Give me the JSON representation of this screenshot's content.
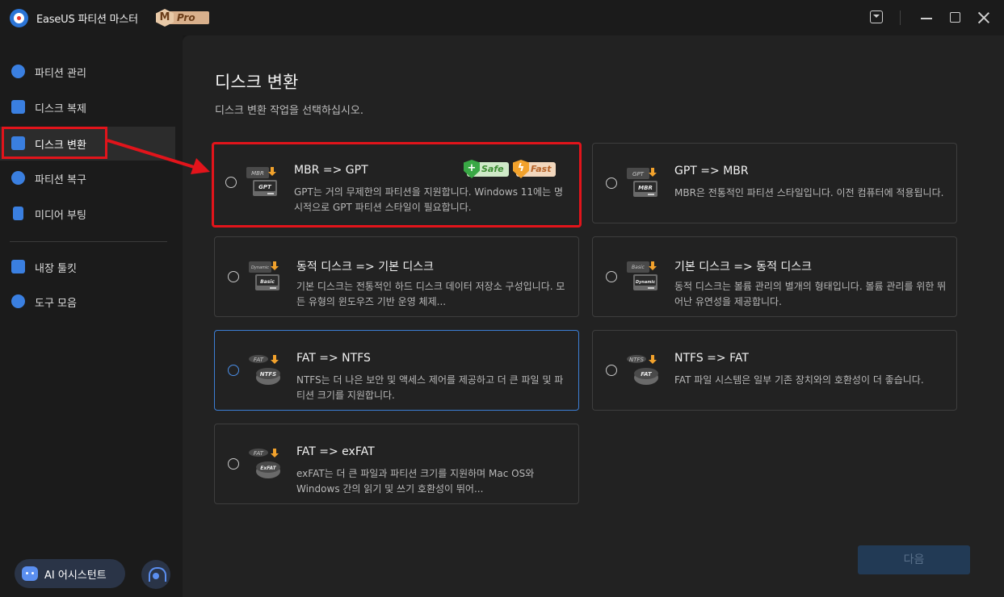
{
  "app": {
    "title": "EaseUS 파티션 마스터",
    "badge_letter": "M",
    "badge_text": "Pro"
  },
  "sidebar": {
    "items": [
      {
        "label": "파티션 관리",
        "icon": "partition-pie-icon"
      },
      {
        "label": "디스크 복제",
        "icon": "disk-clone-icon"
      },
      {
        "label": "디스크 변환",
        "icon": "disk-convert-icon",
        "active": true
      },
      {
        "label": "파티션 복구",
        "icon": "partition-recovery-icon"
      },
      {
        "label": "미디어 부팅",
        "icon": "media-boot-icon"
      },
      {
        "label": "내장 툴킷",
        "icon": "toolkit-icon"
      },
      {
        "label": "도구 모음",
        "icon": "tools-icon"
      }
    ],
    "ai_assistant": "AI 어시스턴트"
  },
  "main": {
    "title": "디스크 변환",
    "subtitle": "디스크 변환 작업을 선택하십시오.",
    "cards": [
      {
        "title": "MBR => GPT",
        "desc": "GPT는 거의 무제한의 파티션을 지원합니다. Windows 11에는 명시적으로 GPT 파티션 스타일이 필요합니다.",
        "icon_top": "MBR",
        "icon_bottom": "GPT",
        "tags": [
          "Safe",
          "Fast"
        ]
      },
      {
        "title": "GPT => MBR",
        "desc": "MBR은 전통적인 파티션 스타일입니다. 이전 컴퓨터에 적용됩니다.",
        "icon_top": "GPT",
        "icon_bottom": "MBR"
      },
      {
        "title": "동적 디스크  => 기본 디스크",
        "desc": "기본 디스크는 전통적인 하드 디스크 데이터 저장소 구성입니다. 모든 유형의 윈도우즈 기반 운영 체제...",
        "icon_top": "Dynamic",
        "icon_bottom": "Basic"
      },
      {
        "title": "기본 디스크 => 동적 디스크",
        "desc": "동적 디스크는 볼륨 관리의 별개의 형태입니다. 볼륨 관리를 위한 뛰어난 유연성을 제공합니다.",
        "icon_top": "Basic",
        "icon_bottom": "Dynamic"
      },
      {
        "title": "FAT => NTFS",
        "desc": "NTFS는 더 나은 보안 및 액세스 제어를 제공하고 더 큰 파일 및 파티션 크기를 지원합니다.",
        "icon_top": "FAT",
        "icon_bottom": "NTFS"
      },
      {
        "title": "NTFS => FAT",
        "desc": "FAT 파일 시스템은 일부 기존 장치와의 호환성이 더 좋습니다.",
        "icon_top": "NTFS",
        "icon_bottom": "FAT"
      },
      {
        "title": "FAT => exFAT",
        "desc": "exFAT는 더 큰 파일과 파티션 크기를 지원하며 Mac OS와 Windows 간의 읽기 및 쓰기 호환성이 뛰어...",
        "icon_top": "FAT",
        "icon_bottom": "ExFAT"
      }
    ],
    "next_label": "다음"
  },
  "colors": {
    "accent": "#3c7fd6",
    "annotation_red": "#e2141b",
    "background": "#222222"
  }
}
